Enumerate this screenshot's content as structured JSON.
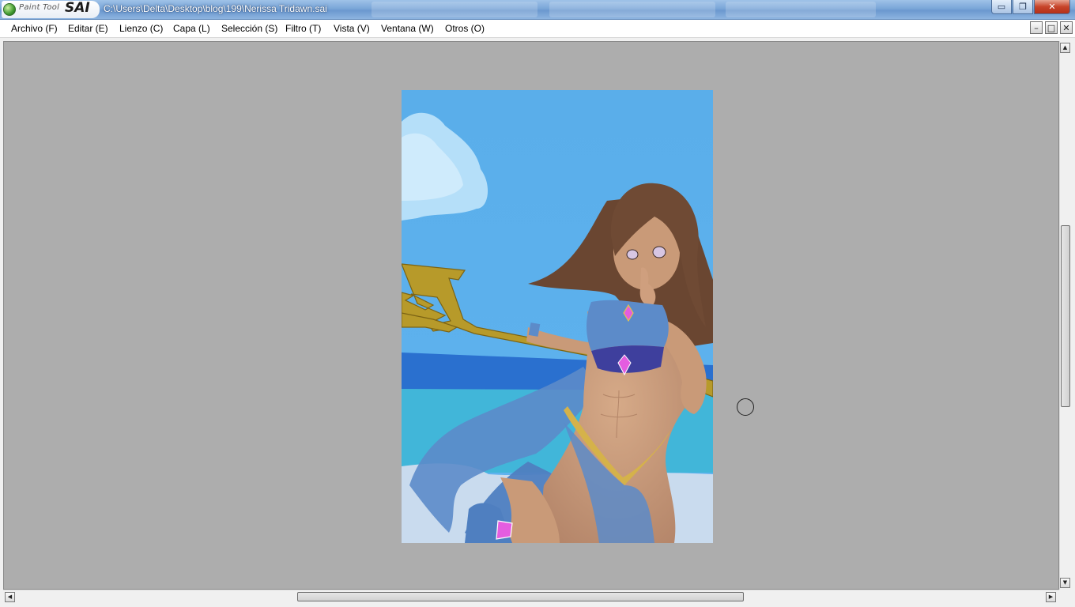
{
  "app": {
    "logo_small": "Paint Tool",
    "logo_big": "SAI",
    "file_path": "C:\\Users\\Delta\\Desktop\\blog\\199\\Nerissa Tridawn.sai"
  },
  "window_controls": {
    "minimize": "▭",
    "restore": "❐",
    "close": "✕"
  },
  "menu": {
    "items": [
      {
        "label": "Archivo (F)"
      },
      {
        "label": "Editar (E)"
      },
      {
        "label": "Lienzo (C)"
      },
      {
        "label": "Capa (L)"
      },
      {
        "label": "Selección (S)"
      },
      {
        "label": "Filtro (T)"
      },
      {
        "label": "Vista (V)"
      },
      {
        "label": "Ventana (W)"
      },
      {
        "label": "Otros (O)"
      }
    ]
  },
  "mdi_controls": {
    "minimize": "–",
    "maximize": "□",
    "close": "✕"
  },
  "scroll": {
    "up": "▲",
    "down": "▼",
    "left": "◀",
    "right": "▶"
  },
  "colors": {
    "workspace": "#adadad",
    "sky": "#5eaeea",
    "sea_deep": "#2a70cf",
    "sea_light": "#41b6d9",
    "sand": "#c9dbee",
    "hair": "#6a4631",
    "skin": "#c99a78",
    "outfit": "#5c8bc9",
    "trident": "#b79a2a",
    "gem": "#e45de0"
  }
}
